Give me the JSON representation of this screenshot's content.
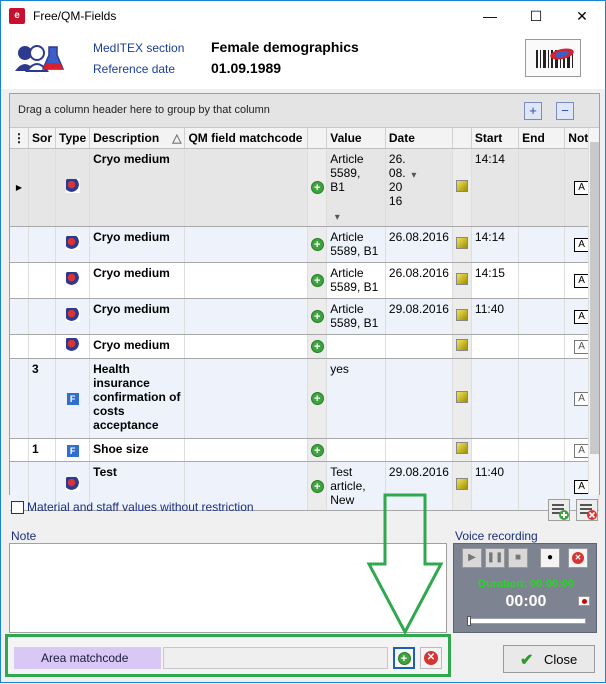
{
  "window": {
    "title": "Free/QM-Fields",
    "app_icon_letter": "e",
    "minimize": "—",
    "maximize": "☐",
    "close": "✕"
  },
  "header": {
    "section_label": "MedITEX section",
    "section_value": "Female demographics",
    "date_label": "Reference date",
    "date_value": "01.09.1989"
  },
  "grid": {
    "group_hint": "Drag a column header here to group by that column",
    "expand_label": "+",
    "collapse_label": "−",
    "columns": [
      "Sor",
      "Type",
      "Description",
      "QM field matchcode",
      "Value",
      "Date",
      "Start",
      "End",
      "Note"
    ],
    "sort_indicator": "△",
    "rows": [
      {
        "sort": "",
        "type": "cryo",
        "description": "Cryo medium",
        "value": "Article 5589, B1",
        "date": "26.08.2016",
        "start": "14:14",
        "end": "",
        "note_style": "solid",
        "selected": true
      },
      {
        "sort": "",
        "type": "cryo",
        "description": "Cryo medium",
        "value": "Article 5589, B1",
        "date": "26.08.2016",
        "start": "14:14",
        "end": "",
        "note_style": "solid"
      },
      {
        "sort": "",
        "type": "cryo",
        "description": "Cryo medium",
        "value": "Article 5589, B1",
        "date": "26.08.2016",
        "start": "14:15",
        "end": "",
        "note_style": "solid"
      },
      {
        "sort": "",
        "type": "cryo",
        "description": "Cryo medium",
        "value": "Article 5589, B1",
        "date": "29.08.2016",
        "start": "11:40",
        "end": "",
        "note_style": "solid"
      },
      {
        "sort": "",
        "type": "cryo",
        "description": "Cryo medium",
        "value": "",
        "date": "",
        "start": "",
        "end": "",
        "note_style": "faint"
      },
      {
        "sort": "3",
        "type": "F",
        "description": "Health insurance confirmation of costs acceptance",
        "value": "yes",
        "date": "",
        "start": "",
        "end": "",
        "note_style": "faint"
      },
      {
        "sort": "1",
        "type": "F",
        "description": "Shoe size",
        "value": "",
        "date": "",
        "start": "",
        "end": "",
        "note_style": "faint"
      },
      {
        "sort": "",
        "type": "cryo",
        "description": "Test",
        "value": "Test article, New",
        "date": "29.08.2016",
        "start": "11:40",
        "end": "",
        "note_style": "solid"
      }
    ]
  },
  "options": {
    "unrestricted_label": "Material and staff values without restriction"
  },
  "note": {
    "label": "Note",
    "text": ""
  },
  "voice": {
    "label": "Voice recording",
    "duration": "Duration: 00:00:00",
    "time": "00:00",
    "slider_position": 0
  },
  "area": {
    "label": "Area matchcode",
    "value": ""
  },
  "footer": {
    "close_label": "Close"
  },
  "colors": {
    "highlight_green": "#2fa84f",
    "area_label_bg": "#d9c8f6",
    "label_blue": "#1a2f80"
  }
}
